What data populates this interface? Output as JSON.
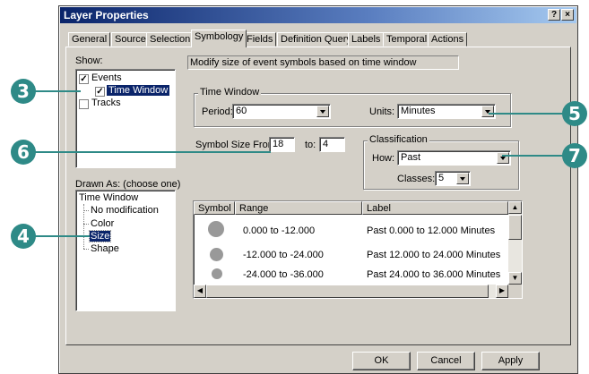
{
  "window": {
    "title": "Layer Properties",
    "help_btn": "?",
    "close_btn": "×"
  },
  "tabs": [
    "General",
    "Source",
    "Selection",
    "Symbology",
    "Fields",
    "Definition Query",
    "Labels",
    "Temporal",
    "Actions"
  ],
  "active_tab": "Symbology",
  "show": {
    "label": "Show:",
    "items": [
      {
        "label": "Events",
        "checked": true
      },
      {
        "label": "Time Window",
        "checked": true,
        "selected": true
      },
      {
        "label": "Tracks",
        "checked": false
      }
    ]
  },
  "description": "Modify size of event symbols based on time window",
  "time_window": {
    "group_label": "Time Window",
    "period_label": "Period:",
    "period_value": "60",
    "units_label": "Units:",
    "units_value": "Minutes"
  },
  "symbol_size": {
    "from_label": "Symbol Size From:",
    "from_value": "18",
    "to_label": "to:",
    "to_value": "4"
  },
  "classification": {
    "group_label": "Classification",
    "how_label": "How:",
    "how_value": "Past",
    "classes_label": "Classes:",
    "classes_value": "5"
  },
  "drawn_as": {
    "label": "Drawn As: (choose one)",
    "root": "Time Window",
    "items": [
      "No modification",
      "Color",
      "Size",
      "Shape"
    ],
    "selected": "Size"
  },
  "table": {
    "headers": [
      "Symbol",
      "Range",
      "Label"
    ],
    "rows": [
      {
        "range": "0.000 to -12.000",
        "label": "Past 0.000 to 12.000 Minutes"
      },
      {
        "range": "-12.000 to -24.000",
        "label": "Past 12.000 to 24.000 Minutes"
      },
      {
        "range": "-24.000 to -36.000",
        "label": "Past 24.000 to 36.000 Minutes"
      }
    ]
  },
  "buttons": {
    "ok": "OK",
    "cancel": "Cancel",
    "apply": "Apply"
  },
  "callouts": [
    "3",
    "4",
    "5",
    "6",
    "7"
  ],
  "colors": {
    "callout": "#2e8a87",
    "title_bar": "#0a246a",
    "selection": "#0a246a",
    "symbol": "#999999"
  }
}
